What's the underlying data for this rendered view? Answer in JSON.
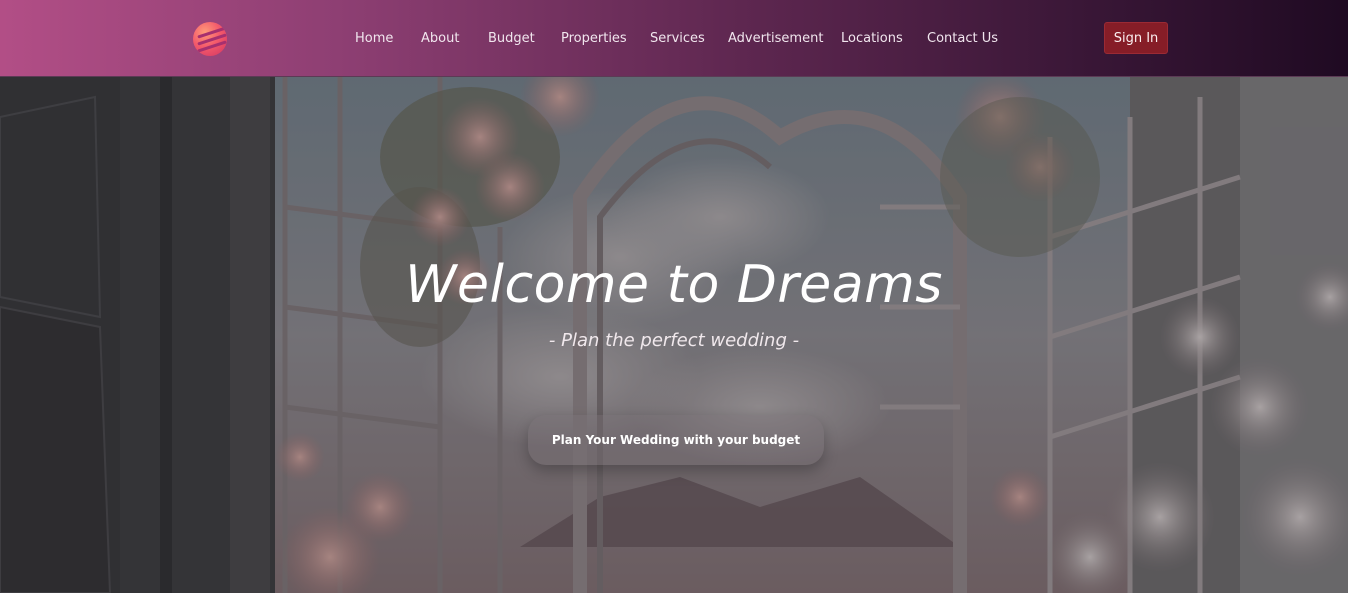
{
  "header": {
    "nav": [
      {
        "label": "Home"
      },
      {
        "label": "About"
      },
      {
        "label": "Budget"
      },
      {
        "label": "Properties"
      },
      {
        "label": "Services"
      },
      {
        "label": "Advertisement"
      },
      {
        "label": "Locations"
      },
      {
        "label": "Contact Us"
      }
    ],
    "signin_label": "Sign In",
    "logo_icon": "globe-logo-icon"
  },
  "hero": {
    "title": "Welcome to Dreams",
    "subtitle": "- Plan the perfect wedding -",
    "cta_label": "Plan Your Wedding with your budget"
  },
  "colors": {
    "header_start": "#b24e86",
    "header_end": "#1f0a22",
    "signin_bg": "#861d27"
  }
}
